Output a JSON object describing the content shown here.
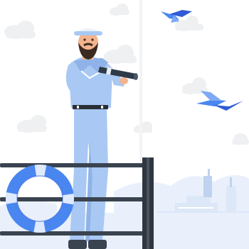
{
  "scene": {
    "subject": "sailor-with-spyglass",
    "icons": [
      "cloud-icon",
      "bird-icon",
      "lifebuoy-icon",
      "ship-icon",
      "railing-icon"
    ],
    "colors": {
      "background": "#ffffff",
      "cloud": "#eef0f2",
      "sky_wash": "#e9f0fb",
      "uniform": "#a9c8f3",
      "uniform_shadow": "#8fb3e8",
      "accent_blue": "#4a86f0",
      "bird_dark": "#2f5bd6",
      "rail": "#3a4350",
      "skin": "#f3b38c",
      "beard": "#3b2a22",
      "ship": "#dce7f7",
      "ship_dark": "#bfd2ef"
    }
  }
}
